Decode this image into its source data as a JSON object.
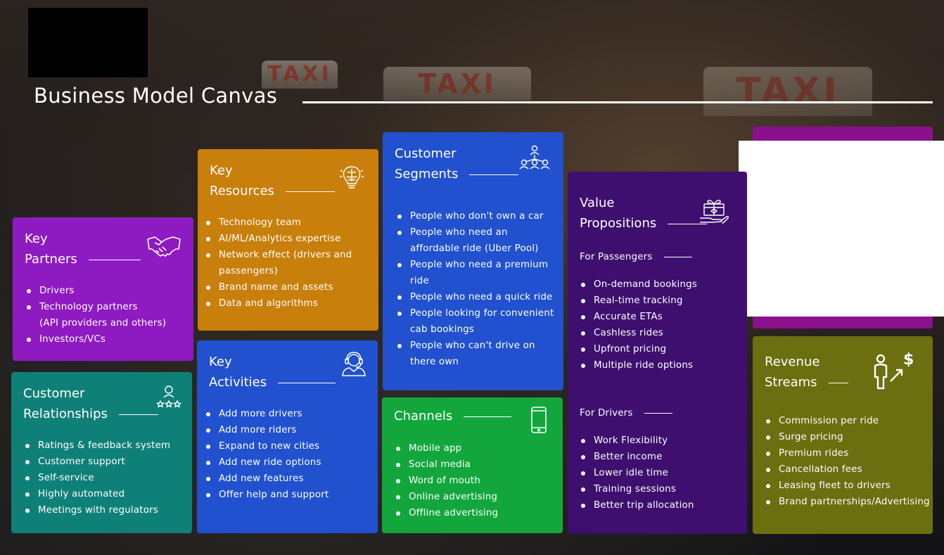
{
  "title": "Business Model Canvas",
  "key_partners": {
    "title_line1": "Key",
    "title_line2": "Partners",
    "items": [
      "Drivers",
      "Technology partners",
      "(API providers and others)",
      "Investors/VCs"
    ]
  },
  "customer_relationships": {
    "title_line1": "Customer",
    "title_line2": "Relationships",
    "items": [
      "Ratings & feedback system",
      "Customer support",
      "Self-service",
      "Highly automated",
      "Meetings with regulators"
    ]
  },
  "key_resources": {
    "title_line1": "Key",
    "title_line2": "Resources",
    "items": [
      "Technology team",
      "AI/ML/Analytics expertise",
      "Network effect (drivers and",
      "passengers)",
      "Brand name and assets",
      "Data and algorithms"
    ]
  },
  "key_activities": {
    "title_line1": "Key",
    "title_line2": "Activities",
    "items": [
      "Add more drivers",
      "Add more riders",
      "Expand to new cities",
      "Add new ride options",
      "Add new features",
      "Offer help and support"
    ]
  },
  "customer_segments": {
    "title_line1": "Customer",
    "title_line2": "Segments",
    "items": [
      "People who don't own a car",
      "People who need an",
      "affordable ride (Uber Pool)",
      "People who need a premium",
      "ride",
      "People who need a quick ride",
      "People looking for convenient",
      "cab bookings",
      "People who can't drive on",
      "there own"
    ]
  },
  "channels": {
    "title": "Channels",
    "items": [
      "Mobile app",
      "Social media",
      "Word of mouth",
      "Online advertising",
      "Offline advertising"
    ]
  },
  "value_propositions": {
    "title_line1": "Value",
    "title_line2": "Propositions",
    "passengers_label": "For Passengers",
    "passengers": [
      "On-demand bookings",
      "Real-time tracking",
      "Accurate ETAs",
      "Cashless rides",
      "Upfront pricing",
      "Multiple ride options"
    ],
    "drivers_label": "For Drivers",
    "drivers": [
      "Work Flexibility",
      "Better income",
      "Lower idle time",
      "Training sessions",
      "Better trip allocation"
    ]
  },
  "revenue_streams": {
    "title_line1": "Revenue",
    "title_line2": "Streams",
    "items": [
      "Commission per ride",
      "Surge pricing",
      "Premium rides",
      "Cancellation fees",
      "Leasing fleet to drivers",
      "Brand partnerships/Advertising"
    ]
  },
  "background_signs": [
    "TAXI",
    "TAXI",
    "TAXI"
  ],
  "colors": {
    "key_partners": "#8e1bc1",
    "customer_relationships": "#0f8078",
    "key_resources": "#c97f0c",
    "key_activities": "#2251cf",
    "customer_segments": "#2251cf",
    "channels": "#13a63c",
    "value_propositions": "#3e0f6e",
    "revenue_streams": "#6b6f10",
    "cost_structure": "#8b108e"
  }
}
